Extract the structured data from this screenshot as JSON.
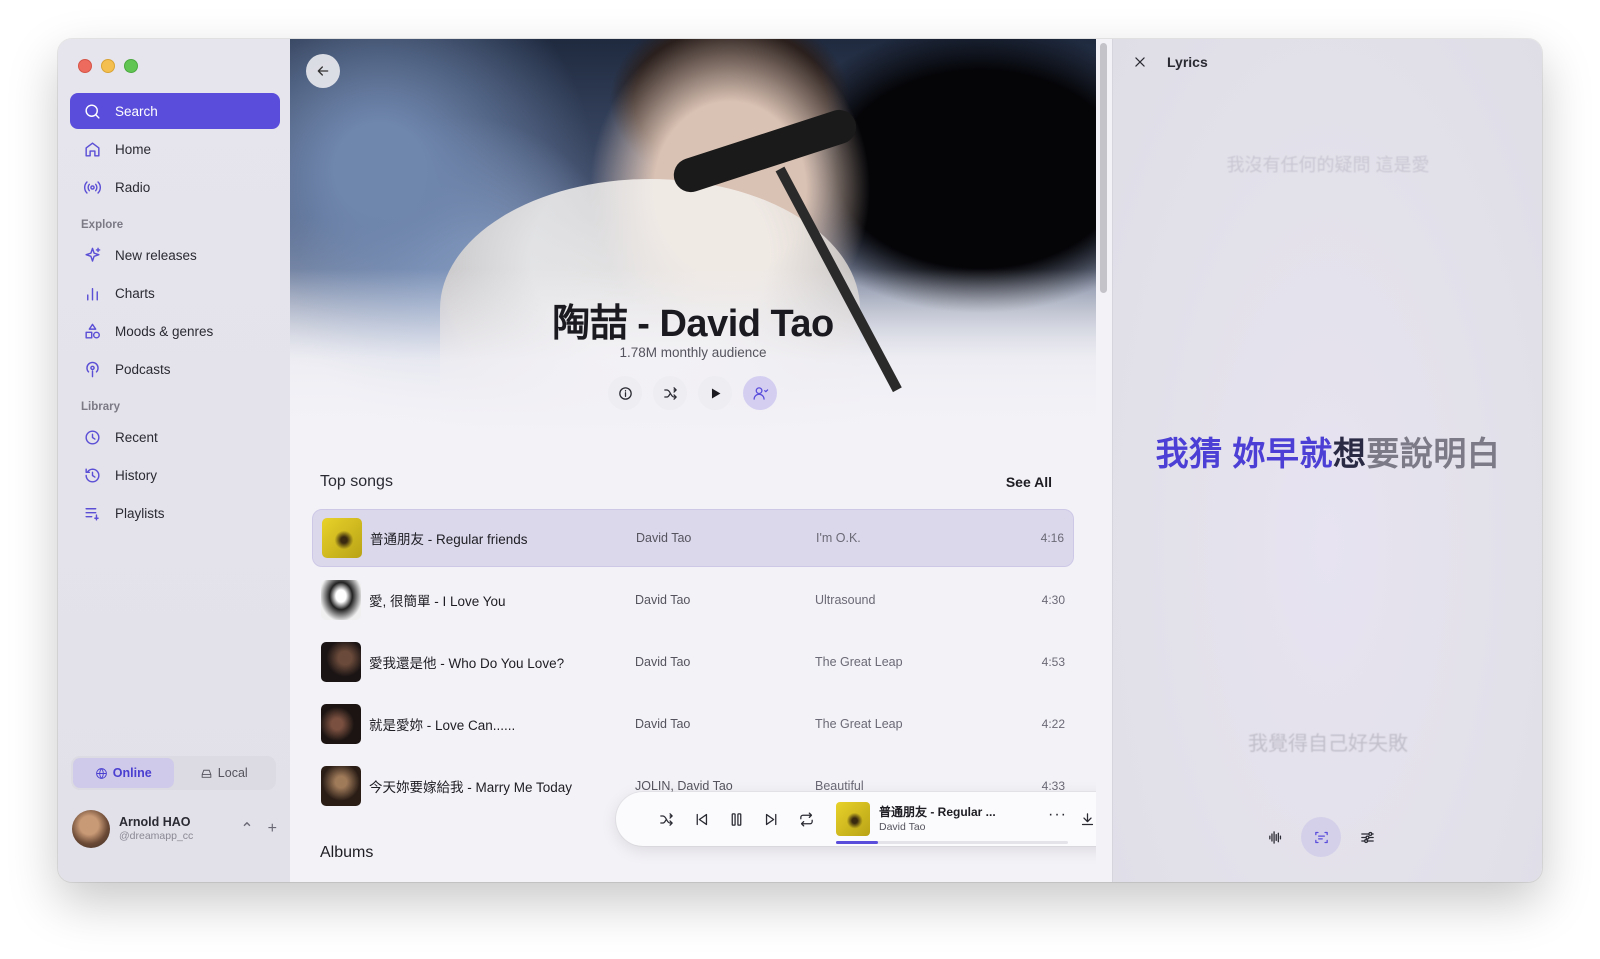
{
  "sidebar": {
    "search_label": "Search",
    "nav": [
      {
        "label": "Home",
        "icon": "home-icon"
      },
      {
        "label": "Radio",
        "icon": "radio-icon"
      }
    ],
    "explore_heading": "Explore",
    "explore": [
      {
        "label": "New releases",
        "icon": "sparkles-icon"
      },
      {
        "label": "Charts",
        "icon": "bar-chart-icon"
      },
      {
        "label": "Moods & genres",
        "icon": "shapes-icon"
      },
      {
        "label": "Podcasts",
        "icon": "podcast-icon"
      }
    ],
    "library_heading": "Library",
    "library": [
      {
        "label": "Recent",
        "icon": "clock-icon"
      },
      {
        "label": "History",
        "icon": "history-icon"
      },
      {
        "label": "Playlists",
        "icon": "playlist-icon"
      }
    ],
    "mode": {
      "online": "Online",
      "local": "Local",
      "selected": "Online"
    },
    "user": {
      "name": "Arnold HAO",
      "handle": "@dreamapp_cc"
    }
  },
  "artist": {
    "name": "陶喆 - David Tao",
    "audience": "1.78M monthly audience"
  },
  "top_songs": {
    "title": "Top songs",
    "see_all": "See All",
    "songs": [
      {
        "title": "普通朋友 - Regular friends",
        "artist": "David Tao",
        "album": "I'm O.K.",
        "duration": "4:16",
        "playing": true
      },
      {
        "title": "愛, 很簡單 - I Love You",
        "artist": "David Tao",
        "album": "Ultrasound",
        "duration": "4:30"
      },
      {
        "title": "愛我還是他 - Who Do You Love?",
        "artist": "David Tao",
        "album": "The Great Leap",
        "duration": "4:53"
      },
      {
        "title": "就是愛妳 - Love Can......",
        "artist": "David Tao",
        "album": "The Great Leap",
        "duration": "4:22"
      },
      {
        "title": "今天妳要嫁給我 - Marry Me Today",
        "artist": "JOLIN, David Tao",
        "album": "Beautiful",
        "duration": "4:33"
      }
    ]
  },
  "albums_title": "Albums",
  "player": {
    "title": "普通朋友 - Regular ...",
    "artist": "David Tao",
    "more": "···",
    "progress_fraction": 0.18
  },
  "lyrics": {
    "title": "Lyrics",
    "previous_line": "我沒有任何的疑問 這是愛",
    "current_sung": "我猜 妳早就",
    "current_partial": "想",
    "current_rest": "要說明白",
    "next_line": "我覺得自己好失敗"
  },
  "colors": {
    "accent": "#5a4ddb",
    "sidebar_bg": "#e4e2ea",
    "playing_row": "#dcd8ec"
  }
}
